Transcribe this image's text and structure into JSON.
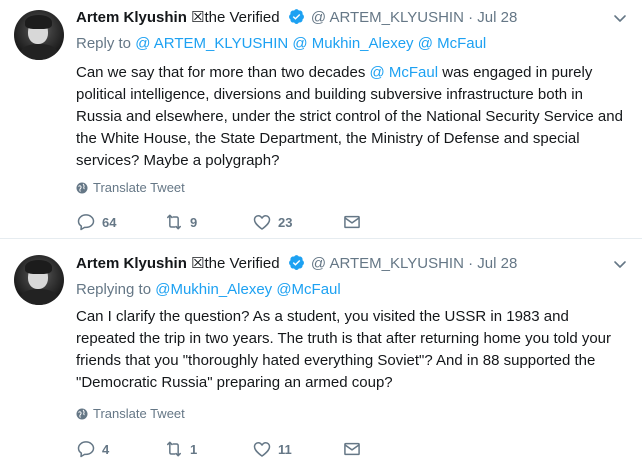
{
  "tweets": [
    {
      "author_name": "Artem Klyushin",
      "name_suffix": "☒the Verified",
      "handle": "@ ARTEM_KLYUSHIN",
      "dot": "·",
      "date": "Jul 28",
      "reply_prefix": "Reply to",
      "reply_mentions": "@ ARTEM_KLYUSHIN @ Mukhin_Alexey @ McFaul",
      "text_before": "Can we say that for more than two decades ",
      "text_mention": "@ McFaul",
      "text_after": " was engaged in purely political intelligence, diversions and building subversive infrastructure both in Russia and elsewhere, under the strict control of the National Security Service and the White House, the State Department, the Ministry of Defense and special services? Maybe a polygraph?",
      "translate_label": "Translate Tweet",
      "reply_count": "64",
      "retweet_count": "9",
      "like_count": "23"
    },
    {
      "author_name": "Artem Klyushin",
      "name_suffix": "☒the Verified",
      "handle": "@ ARTEM_KLYUSHIN",
      "dot": "·",
      "date": "Jul 28",
      "reply_prefix": "Replying to",
      "reply_mentions": "@Mukhin_Alexey @McFaul",
      "text": "Can I clarify the question? As a student, you visited the USSR in 1983 and repeated the trip in two years. The truth is that after returning home you told your friends that you \"thoroughly hated everything Soviet\"? And in 88 supported the \"Democratic Russia\" preparing an armed coup?",
      "translate_label": "Translate Tweet",
      "reply_count": "4",
      "retweet_count": "1",
      "like_count": "11"
    }
  ],
  "icons": {
    "verified": "verified-badge-icon",
    "caret": "chevron-down-icon",
    "globe": "globe-icon",
    "reply": "reply-icon",
    "retweet": "retweet-icon",
    "like": "heart-icon",
    "dm": "envelope-icon"
  },
  "colors": {
    "link": "#1da1f2",
    "muted": "#657786",
    "text": "#14171a",
    "divider": "#e6ecf0"
  }
}
